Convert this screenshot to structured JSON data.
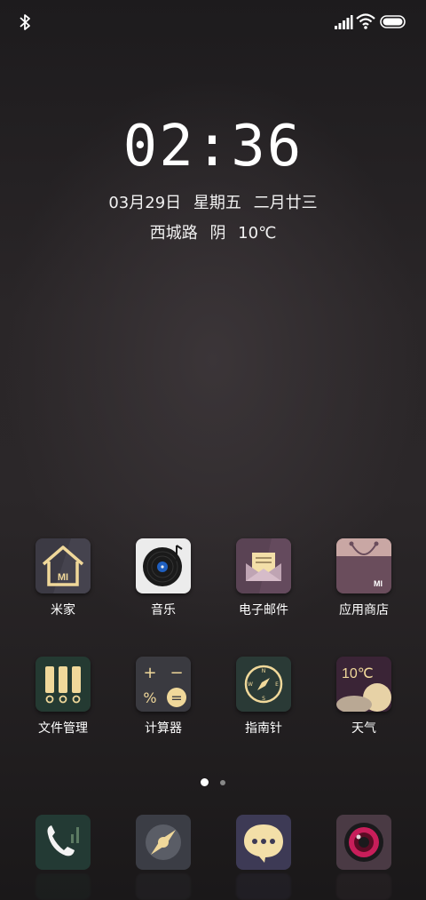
{
  "status_bar": {
    "bluetooth_icon": "bluetooth-icon",
    "signal_icon": "signal-icon",
    "wifi_icon": "wifi-icon",
    "battery_icon": "battery-icon"
  },
  "clock": {
    "time": "02:36",
    "date": "03月29日",
    "weekday": "星期五",
    "lunar": "二月廿三",
    "location": "西城路",
    "condition": "阴",
    "temperature": "10℃"
  },
  "apps": [
    {
      "label": "米家",
      "icon": "home-icon"
    },
    {
      "label": "音乐",
      "icon": "vinyl-record-icon"
    },
    {
      "label": "电子邮件",
      "icon": "envelope-icon"
    },
    {
      "label": "应用商店",
      "icon": "shopping-bag-icon"
    },
    {
      "label": "文件管理",
      "icon": "folders-icon"
    },
    {
      "label": "计算器",
      "icon": "calculator-icon"
    },
    {
      "label": "指南针",
      "icon": "compass-icon"
    },
    {
      "label": "天气",
      "icon": "weather-icon"
    }
  ],
  "weather_icon_temp": "10℃",
  "home_badge": "MI",
  "store_badge": "MI",
  "calc_symbols": {
    "plus": "+",
    "minus": "−",
    "percent": "%",
    "equals": "="
  },
  "page_indicator": {
    "pages": 2,
    "current": 1
  },
  "dock": [
    {
      "icon": "phone-icon"
    },
    {
      "icon": "browser-icon"
    },
    {
      "icon": "messages-icon"
    },
    {
      "icon": "camera-icon"
    }
  ],
  "colors": {
    "icon_gold": "#f0d89a",
    "icon_dark": "#3c3a44",
    "mail_bg": "#5a4354",
    "store_bg": "#6a4d5c",
    "compass_bg": "#2a3a36"
  }
}
